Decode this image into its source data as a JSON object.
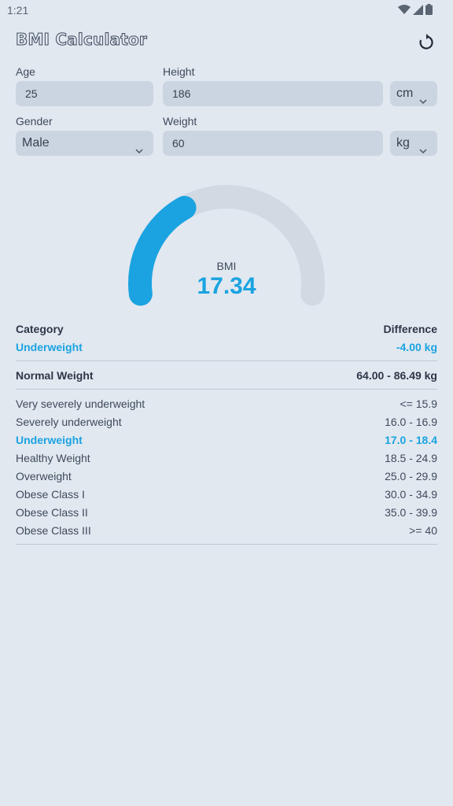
{
  "status_bar": {
    "time": "1:21"
  },
  "app_bar": {
    "title": "BMI Calculator",
    "reset_icon": "refresh-icon"
  },
  "form": {
    "age": {
      "label": "Age",
      "value": "25"
    },
    "height": {
      "label": "Height",
      "value": "186",
      "unit": "cm"
    },
    "gender": {
      "label": "Gender",
      "value": "Male"
    },
    "weight": {
      "label": "Weight",
      "value": "60",
      "unit": "kg"
    }
  },
  "gauge": {
    "label": "BMI",
    "value": "17.34",
    "fill_fraction": 0.35,
    "accent": "#1aa3e0",
    "track": "#d1d9e3"
  },
  "result": {
    "category_header": "Category",
    "difference_header": "Difference",
    "category": "Underweight",
    "difference": "-4.00 kg",
    "normal_label": "Normal Weight",
    "normal_range": "64.00 - 86.49 kg"
  },
  "categories": [
    {
      "name": "Very severely underweight",
      "range": "<= 15.9",
      "active": false
    },
    {
      "name": "Severely underweight",
      "range": "16.0 - 16.9",
      "active": false
    },
    {
      "name": "Underweight",
      "range": "17.0 - 18.4",
      "active": true
    },
    {
      "name": "Healthy Weight",
      "range": "18.5 - 24.9",
      "active": false
    },
    {
      "name": "Overweight",
      "range": "25.0 - 29.9",
      "active": false
    },
    {
      "name": "Obese Class I",
      "range": "30.0 - 34.9",
      "active": false
    },
    {
      "name": "Obese Class II",
      "range": "35.0 - 39.9",
      "active": false
    },
    {
      "name": "Obese Class III",
      "range": ">= 40",
      "active": false
    }
  ]
}
